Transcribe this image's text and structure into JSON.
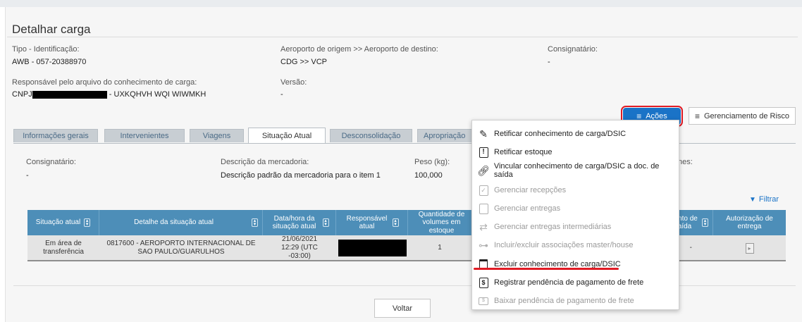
{
  "page": {
    "title": "Detalhar carga"
  },
  "header": {
    "tipo_label": "Tipo - Identificação:",
    "tipo_value": "AWB - 057-20388970",
    "aeroporto_label": "Aeroporto de origem >> Aeroporto de destino:",
    "aeroporto_value": "CDG >> VCP",
    "consignatario_label": "Consignatário:",
    "consignatario_value": "-",
    "responsavel_label": "Responsável pelo arquivo do conhecimento de carga:",
    "responsavel_prefix": "CNPJ",
    "responsavel_suffix": "- UXKQHVH WQI WIWMKH",
    "versao_label": "Versão:",
    "versao_value": "-"
  },
  "toolbar": {
    "acoes_label": "Ações",
    "risco_label": "Gerenciamento de Risco",
    "menu_icon": "hamburger-icon"
  },
  "tabs": [
    {
      "label": "Informações gerais"
    },
    {
      "label": "Intervenientes"
    },
    {
      "label": "Viagens"
    },
    {
      "label": "Situação Atual"
    },
    {
      "label": "Desconsolidação"
    },
    {
      "label": "Apropriação"
    }
  ],
  "detail": {
    "consignatario_label": "Consignatário:",
    "consignatario_value": "-",
    "descricao_label": "Descrição da mercadoria:",
    "descricao_value": "Descrição padrão da mercadoria para o item 1",
    "peso_label": "Peso (kg):",
    "peso_value": "100,000",
    "partial_label": "nes:"
  },
  "filter": {
    "label": "Filtrar"
  },
  "table": {
    "headers": [
      "Situação atual",
      "Detalhe da situação atual",
      "Data/hora da situação atual",
      "Responsável atual",
      "Quantidade de volumes em estoque",
      "mento de saída",
      "Autorização de entrega"
    ],
    "row": {
      "situacao": "Em área de transferência",
      "detalhe": "0817600 - AEROPORTO INTERNACIONAL DE SAO PAULO/GUARULHOS",
      "datahora": "21/06/2021 12:29 (UTC -03:00)",
      "quantidade": "1",
      "saida": "-"
    }
  },
  "footer": {
    "voltar_label": "Voltar"
  },
  "menu": {
    "items": [
      {
        "label": "Retificar conhecimento de carga/DSIC",
        "icon": "pencil-icon",
        "enabled": true
      },
      {
        "label": "Retificar estoque",
        "icon": "alert-box-icon",
        "enabled": true
      },
      {
        "label": "Vincular conhecimento de carga/DSIC a doc. de saída",
        "icon": "link-icon",
        "enabled": true
      },
      {
        "label": "Gerenciar recepções",
        "icon": "check-doc-icon",
        "enabled": false
      },
      {
        "label": "Gerenciar entregas",
        "icon": "doc-icon",
        "enabled": false
      },
      {
        "label": "Gerenciar entregas intermediárias",
        "icon": "transfer-icon",
        "enabled": false
      },
      {
        "label": "Incluir/excluir associações master/house",
        "icon": "hierarchy-icon",
        "enabled": false
      },
      {
        "label": "Excluir conhecimento de carga/DSIC",
        "icon": "trash-icon",
        "enabled": true
      },
      {
        "label": "Registrar pendência de pagamento de frete",
        "icon": "dollar-doc-icon",
        "enabled": true
      },
      {
        "label": "Baixar pendência de pagamento de frete",
        "icon": "money-icon",
        "enabled": false
      }
    ]
  }
}
